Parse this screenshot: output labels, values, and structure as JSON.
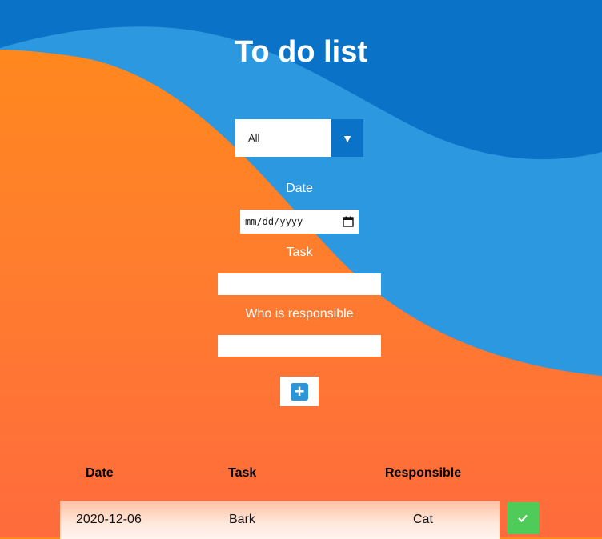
{
  "title": "To do list",
  "filter": {
    "selected": "All",
    "arrow": "▼"
  },
  "form": {
    "date_label": "Date",
    "date_placeholder": "mm/dd/yyyy",
    "task_label": "Task",
    "task_value": "",
    "responsible_label": "Who is responsible",
    "responsible_value": "",
    "add_icon": "plus-square-icon"
  },
  "table": {
    "headers": {
      "date": "Date",
      "task": "Task",
      "responsible": "Responsible"
    },
    "rows": [
      {
        "date": "2020-12-06",
        "task": "Bark",
        "responsible": "Cat",
        "done_icon": "check-icon"
      }
    ]
  },
  "colors": {
    "orange_top": "#ff8a1a",
    "orange_bottom": "#ff6b3d",
    "blue_dark": "#0a73c7",
    "blue_light": "#2b98e0",
    "done_green": "#4fcb5a"
  }
}
